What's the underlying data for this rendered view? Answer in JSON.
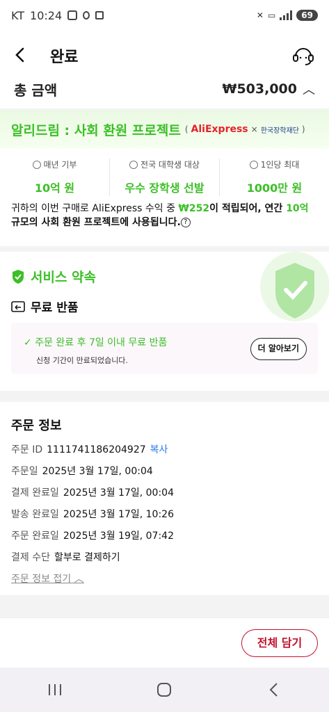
{
  "status": {
    "carrier": "KT",
    "time": "10:24",
    "battery": "69"
  },
  "header": {
    "title": "완료",
    "back_icon": "chevron-left-icon",
    "support_icon": "headset-icon"
  },
  "total": {
    "label": "총 금액",
    "value": "₩503,000"
  },
  "charity": {
    "title": "알리드림 : 사회 환원 프로젝트",
    "partner_ali": "AliExpress",
    "partner_sep": "×",
    "partner_kosaf": "한국장학재단",
    "stats": [
      {
        "label": "매년 기부",
        "value": "10억 원"
      },
      {
        "label": "전국 대학생 대상",
        "value": "우수 장학생 선발"
      },
      {
        "label": "1인당 최대",
        "value": "1000만 원"
      }
    ],
    "desc_part1": "귀하의 이번 구매로 AliExpress 수익 중 ",
    "desc_amount": "₩252",
    "desc_part2": "이 적립되어, 연간 ",
    "desc_year": "10억",
    "desc_part3": "규모의 사회 환원 프로젝트에 사용됩니다."
  },
  "service": {
    "title": "서비스 약속",
    "free_return": "무료 반품",
    "return_text": "주문 완료 후 7일 이내 무료 반품",
    "return_sub": "신청 기간이 만료되었습니다.",
    "learn_more": "더 알아보기"
  },
  "order": {
    "title": "주문 정보",
    "rows": [
      {
        "key": "주문 ID",
        "value": "1111741186204927",
        "action": "복사"
      },
      {
        "key": "주문일",
        "value": "2025년 3월 17일, 00:04"
      },
      {
        "key": "결제 완료일",
        "value": "2025년 3월 17일, 00:04"
      },
      {
        "key": "발송 완료일",
        "value": "2025년 3월 17일, 10:26"
      },
      {
        "key": "주문 완료일",
        "value": "2025년 3월 19일, 07:42"
      },
      {
        "key": "결제 수단",
        "value": "할부로 결제하기"
      }
    ],
    "fold": "주문 정보 접기"
  },
  "bottom": {
    "add_all": "전체 담기"
  },
  "colors": {
    "green": "#3cbf27",
    "red": "#c0112b",
    "link": "#2c7be5"
  }
}
